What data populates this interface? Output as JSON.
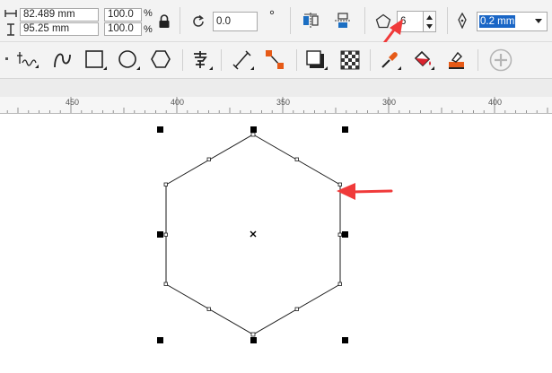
{
  "property_bar": {
    "width_value": "82.489 mm",
    "height_value": "95.25 mm",
    "scale_x": "100.0",
    "scale_y": "100.0",
    "percent_symbol": "%",
    "rotation_value": "0.0",
    "degree_symbol": "°",
    "polygon_points": "6",
    "outline_width": "0.2 mm",
    "outline_highlight": "#1a66c6"
  },
  "ruler": {
    "labels": [
      "450",
      "400",
      "350",
      "300",
      "400"
    ]
  },
  "annotation": {
    "arrow_color": "#f03a3a"
  },
  "icons": {
    "toolbox": [
      "smart-fill-icon",
      "freehand-icon",
      "artistic-curve-icon",
      "rectangle-icon",
      "ellipse-icon",
      "polygon-icon",
      "text-icon",
      "parallel-dimension-icon",
      "connector-icon",
      "drop-shadow-icon",
      "transparency-icon",
      "color-eyedropper-icon",
      "interactive-fill-icon",
      "smart-fill-tool-icon",
      "add-tool-icon"
    ]
  }
}
